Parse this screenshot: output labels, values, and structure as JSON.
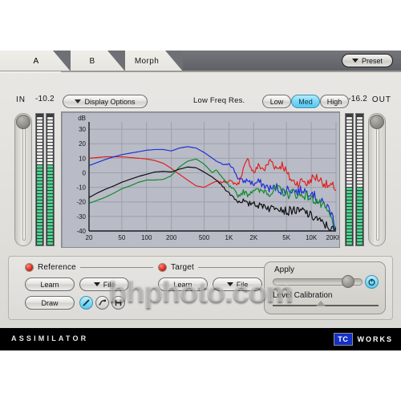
{
  "app": {
    "name": "ASSIMILATOR",
    "vendor_box": "TC",
    "vendor_name": "WORKS",
    "watermark": "bhphoto.com"
  },
  "tabs": [
    {
      "label": "A",
      "active": true
    },
    {
      "label": "B",
      "active": false
    },
    {
      "label": "Morph",
      "active": false
    }
  ],
  "preset": {
    "label": "Preset",
    "icon": "chevron-down-icon"
  },
  "toolbar": {
    "in_label": "IN",
    "in_value": "-10.2",
    "out_label": "OUT",
    "out_value": "-16.2",
    "display_options_label": "Display Options",
    "low_freq_res_label": "Low Freq Res.",
    "low_freq_res_options": [
      {
        "label": "Low",
        "selected": false
      },
      {
        "label": "Med",
        "selected": true
      },
      {
        "label": "High",
        "selected": false
      }
    ]
  },
  "reference": {
    "title": "Reference",
    "learn_label": "Learn",
    "file_label": "File",
    "draw_label": "Draw",
    "tool_icons": [
      "pencil-icon",
      "curve-icon",
      "handle-icon"
    ],
    "pencil_active": true
  },
  "target": {
    "title": "Target",
    "learn_label": "Learn",
    "file_label": "File"
  },
  "apply": {
    "label": "Apply",
    "value_percent": 90,
    "power_icon": "power-icon",
    "power_on": true,
    "level_calibration_label": "Level Calibration",
    "level_calibration_percent": 45
  },
  "meters": {
    "in_percent": 62,
    "out_percent": 46
  },
  "colors": {
    "accent_cyan": "#5cc9ee",
    "led_red": "#e02a18",
    "panel": "#e3e2de",
    "graph_bg": "#b9bcc6",
    "curve_red": "#e02020",
    "curve_blue": "#2030d8",
    "curve_green": "#108a30",
    "curve_black": "#101010"
  },
  "chart_data": {
    "type": "line",
    "title": "",
    "xlabel": "",
    "ylabel": "dB",
    "grid": true,
    "legend": "none",
    "x_scale": "log",
    "xlim": [
      20,
      20000
    ],
    "ylim": [
      -40,
      35
    ],
    "y_ticks": [
      30,
      20,
      10,
      0,
      -10,
      -20,
      -30,
      -40
    ],
    "x_ticks": [
      20,
      50,
      100,
      200,
      500,
      1000,
      2000,
      5000,
      10000,
      20000
    ],
    "x_tick_labels": [
      "20",
      "50",
      "100",
      "200",
      "500",
      "1K",
      "2K",
      "5K",
      "10K",
      "20KHZ"
    ],
    "x": [
      20,
      25,
      31,
      40,
      50,
      63,
      80,
      100,
      125,
      160,
      200,
      250,
      315,
      400,
      500,
      630,
      700,
      800,
      900,
      1000,
      1150,
      1300,
      1500,
      1700,
      2000,
      2300,
      2700,
      3200,
      3800,
      4500,
      5200,
      6000,
      7000,
      8000,
      9000,
      10000,
      11500,
      13000,
      15000,
      17000,
      19000,
      20000
    ],
    "series": [
      {
        "name": "red",
        "color": "#e02020",
        "values": [
          10,
          10.5,
          11,
          11,
          11,
          10.5,
          10,
          9.5,
          8.5,
          6.5,
          3,
          -1,
          -5,
          -9,
          -10,
          -7,
          -6,
          -6.5,
          -6,
          -5.5,
          -7,
          -8,
          3,
          9,
          0,
          5,
          2,
          9,
          3,
          6,
          -2,
          -6,
          -7,
          -5,
          -8,
          -4,
          -3,
          -5,
          -8,
          -10,
          -9,
          -12
        ]
      },
      {
        "name": "blue",
        "color": "#2030d8",
        "values": [
          5,
          7,
          9,
          11,
          12.5,
          13.5,
          14.5,
          15.5,
          16,
          16,
          15,
          17,
          18,
          17,
          14,
          10,
          8,
          6.5,
          5,
          7,
          2,
          -4,
          -6,
          -5,
          -8,
          -6,
          -9,
          -11,
          -10,
          -13,
          -11,
          -12,
          -13,
          -11,
          -14,
          -12,
          -18,
          -20,
          -22,
          -26,
          -33,
          -40
        ]
      },
      {
        "name": "green",
        "color": "#108a30",
        "values": [
          -21,
          -19,
          -17,
          -14,
          -11,
          -9,
          -6.5,
          -5,
          -5,
          -4.5,
          -2,
          4,
          8,
          9.5,
          6,
          0,
          2,
          -2,
          -6,
          -9,
          -12,
          -16,
          -13,
          -15,
          -11,
          -13,
          -12,
          -14,
          -11,
          -13,
          -15,
          -13,
          -16,
          -15,
          -16,
          -18,
          -19,
          -22,
          -25,
          -30,
          -37,
          -40
        ]
      },
      {
        "name": "black",
        "color": "#101010",
        "values": [
          -17,
          -14,
          -11.5,
          -9,
          -6.5,
          -4.5,
          -2.5,
          -1,
          0.5,
          1,
          0.5,
          2.5,
          4,
          3.5,
          0.5,
          -3,
          -5,
          -8,
          -11,
          -14,
          -17,
          -20,
          -19,
          -22,
          -20,
          -23,
          -22,
          -25,
          -22,
          -25,
          -27,
          -25,
          -27,
          -26,
          -28,
          -30,
          -31,
          -34,
          -36,
          -38,
          -40,
          -40
        ]
      }
    ]
  }
}
